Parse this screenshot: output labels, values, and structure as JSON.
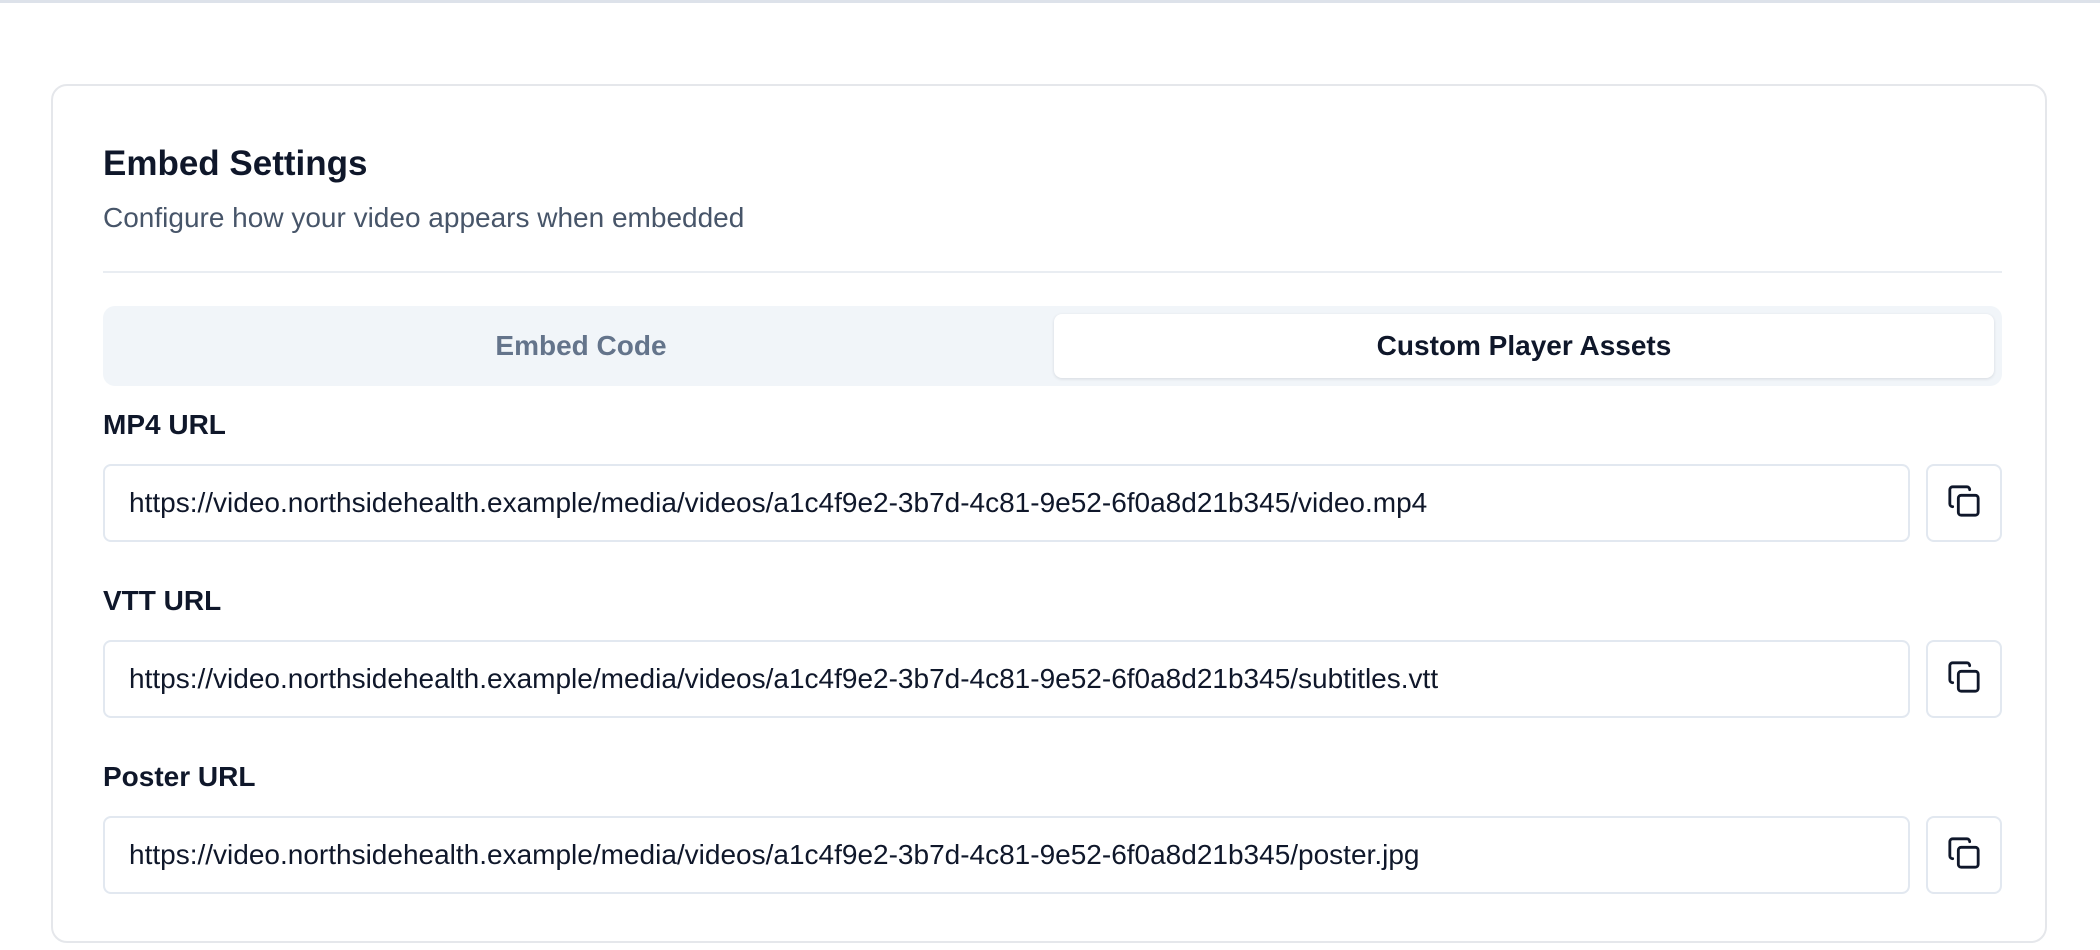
{
  "card": {
    "title": "Embed Settings",
    "subtitle": "Configure how your video appears when embedded"
  },
  "tabs": [
    {
      "label": "Embed Code",
      "active": false
    },
    {
      "label": "Custom Player Assets",
      "active": true
    }
  ],
  "fields": {
    "mp4": {
      "label": "MP4 URL",
      "value": "https://video.northsidehealth.example/media/videos/a1c4f9e2-3b7d-4c81-9e52-6f0a8d21b345/video.mp4",
      "copy_icon": "copy-icon"
    },
    "vtt": {
      "label": "VTT URL",
      "value": "https://video.northsidehealth.example/media/videos/a1c4f9e2-3b7d-4c81-9e52-6f0a8d21b345/subtitles.vtt",
      "copy_icon": "copy-icon"
    },
    "poster": {
      "label": "Poster URL",
      "value": "https://video.northsidehealth.example/media/videos/a1c4f9e2-3b7d-4c81-9e52-6f0a8d21b345/poster.jpg",
      "copy_icon": "copy-icon"
    }
  },
  "colors": {
    "text_primary": "#0f172a",
    "text_muted": "#475569",
    "tab_inactive": "#64748b",
    "tab_track": "#f1f5f9",
    "border": "#e2e8f0"
  }
}
